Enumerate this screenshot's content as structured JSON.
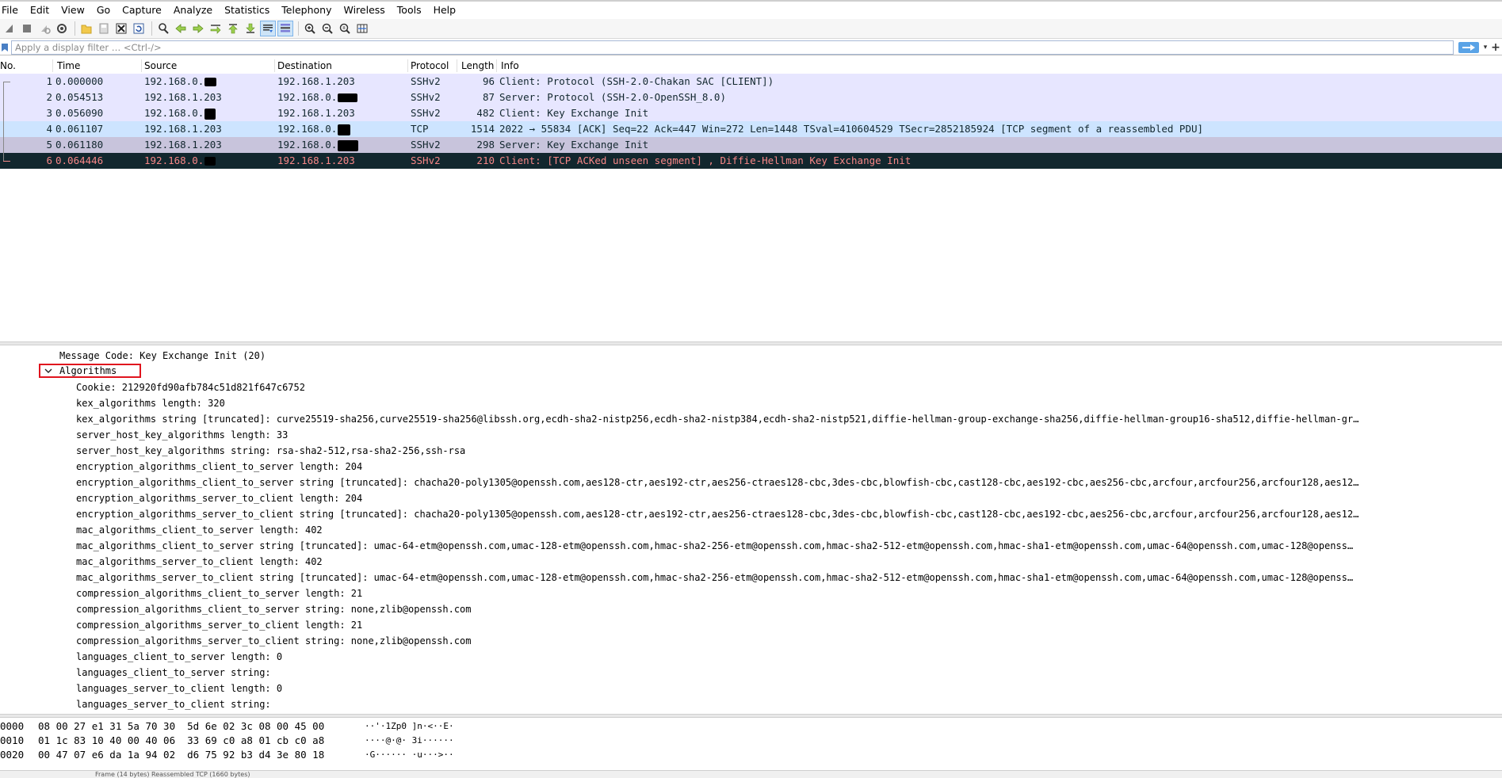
{
  "menu": [
    "File",
    "Edit",
    "View",
    "Go",
    "Capture",
    "Analyze",
    "Statistics",
    "Telephony",
    "Wireless",
    "Tools",
    "Help"
  ],
  "toolbar": {
    "icons": [
      "shark-fin-start-icon",
      "stop-icon",
      "restart-icon",
      "capture-options-icon",
      "open-file-icon",
      "save-file-icon",
      "close-file-icon",
      "reload-icon",
      "find-packet-icon",
      "go-back-icon",
      "go-forward-icon",
      "go-to-packet-icon",
      "go-first-icon",
      "go-last-icon",
      "autoscroll-icon",
      "colorize-icon",
      "zoom-in-icon",
      "zoom-out-icon",
      "zoom-normal-icon",
      "resize-columns-icon"
    ]
  },
  "filter": {
    "placeholder": "Apply a display filter … <Ctrl-/>"
  },
  "packet_list": {
    "columns": [
      "No.",
      "Time",
      "Source",
      "Destination",
      "Protocol",
      "Length",
      "Info"
    ],
    "rows": [
      {
        "no": "1",
        "time": "0.000000",
        "src": "192.168.0.",
        "dst": "192.168.1.203",
        "proto": "SSHv2",
        "len": "96",
        "info": "Client: Protocol (SSH-2.0-Chakan SAC  [CLIENT])",
        "bg": "#e7e6ff",
        "fg": "#12272e"
      },
      {
        "no": "2",
        "time": "0.054513",
        "src": "192.168.1.203",
        "dst": "192.168.0.",
        "proto": "SSHv2",
        "len": "87",
        "info": "Server: Protocol (SSH-2.0-OpenSSH_8.0)",
        "bg": "#e7e6ff",
        "fg": "#12272e"
      },
      {
        "no": "3",
        "time": "0.056090",
        "src": "192.168.0.",
        "dst": "192.168.1.203",
        "proto": "SSHv2",
        "len": "482",
        "info": "Client: Key Exchange Init",
        "bg": "#e7e6ff",
        "fg": "#12272e"
      },
      {
        "no": "4",
        "time": "0.061107",
        "src": "192.168.1.203",
        "dst": "192.168.0.",
        "proto": "TCP",
        "len": "1514",
        "info": "2022 → 55834 [ACK] Seq=22 Ack=447 Win=272 Len=1448 TSval=410604529 TSecr=2852185924 [TCP segment of a reassembled PDU]",
        "bg": "#cde4ff",
        "fg": "#12272e"
      },
      {
        "no": "5",
        "time": "0.061180",
        "src": "192.168.1.203",
        "dst": "192.168.0.",
        "proto": "SSHv2",
        "len": "298",
        "info": "Server: Key Exchange Init",
        "bg": "#c8c4dc",
        "fg": "#12272e"
      },
      {
        "no": "6",
        "time": "0.064446",
        "src": "192.168.0.",
        "dst": "192.168.1.203",
        "proto": "SSHv2",
        "len": "210",
        "info": "Client: [TCP ACKed unseen segment] , Diffie-Hellman Key Exchange Init",
        "bg": "#12272e",
        "fg": "#f78787"
      }
    ]
  },
  "details": {
    "message_code": "Message Code: Key Exchange Init (20)",
    "algorithms_label": "Algorithms",
    "fields": [
      "Cookie: 212920fd90afb784c51d821f647c6752",
      "kex_algorithms length: 320",
      "kex_algorithms string [truncated]: curve25519-sha256,curve25519-sha256@libssh.org,ecdh-sha2-nistp256,ecdh-sha2-nistp384,ecdh-sha2-nistp521,diffie-hellman-group-exchange-sha256,diffie-hellman-group16-sha512,diffie-hellman-gr…",
      "server_host_key_algorithms length: 33",
      "server_host_key_algorithms string: rsa-sha2-512,rsa-sha2-256,ssh-rsa",
      "encryption_algorithms_client_to_server length: 204",
      "encryption_algorithms_client_to_server string [truncated]: chacha20-poly1305@openssh.com,aes128-ctr,aes192-ctr,aes256-ctraes128-cbc,3des-cbc,blowfish-cbc,cast128-cbc,aes192-cbc,aes256-cbc,arcfour,arcfour256,arcfour128,aes12…",
      "encryption_algorithms_server_to_client length: 204",
      "encryption_algorithms_server_to_client string [truncated]: chacha20-poly1305@openssh.com,aes128-ctr,aes192-ctr,aes256-ctraes128-cbc,3des-cbc,blowfish-cbc,cast128-cbc,aes192-cbc,aes256-cbc,arcfour,arcfour256,arcfour128,aes12…",
      "mac_algorithms_client_to_server length: 402",
      "mac_algorithms_client_to_server string [truncated]: umac-64-etm@openssh.com,umac-128-etm@openssh.com,hmac-sha2-256-etm@openssh.com,hmac-sha2-512-etm@openssh.com,hmac-sha1-etm@openssh.com,umac-64@openssh.com,umac-128@openss…",
      "mac_algorithms_server_to_client length: 402",
      "mac_algorithms_server_to_client string [truncated]: umac-64-etm@openssh.com,umac-128-etm@openssh.com,hmac-sha2-256-etm@openssh.com,hmac-sha2-512-etm@openssh.com,hmac-sha1-etm@openssh.com,umac-64@openssh.com,umac-128@openss…",
      "compression_algorithms_client_to_server length: 21",
      "compression_algorithms_client_to_server string: none,zlib@openssh.com",
      "compression_algorithms_server_to_client length: 21",
      "compression_algorithms_server_to_client string: none,zlib@openssh.com",
      "languages_client_to_server length: 0",
      "languages_client_to_server string:",
      "languages_server_to_client length: 0",
      "languages_server_to_client string:"
    ]
  },
  "bytes": [
    {
      "offset": "0000",
      "hex": "08 00 27 e1 31 5a 70 30  5d 6e 02 3c 08 00 45 00",
      "ascii": "··'·1Zp0 ]n·<··E·"
    },
    {
      "offset": "0010",
      "hex": "01 1c 83 10 40 00 40 06  33 69 c0 a8 01 cb c0 a8",
      "ascii": "····@·@· 3i······"
    },
    {
      "offset": "0020",
      "hex": "00 47 07 e6 da 1a 94 02  d6 75 92 b3 d4 3e 80 18",
      "ascii": "·G······ ·u···>··"
    }
  ],
  "status": {
    "text": "Frame (14 bytes)  Reassembled TCP (1660 bytes)"
  },
  "colors": {
    "highlight_box": "#e0141e",
    "selected_row_bg": "#12272e",
    "selected_row_fg": "#f78787"
  }
}
